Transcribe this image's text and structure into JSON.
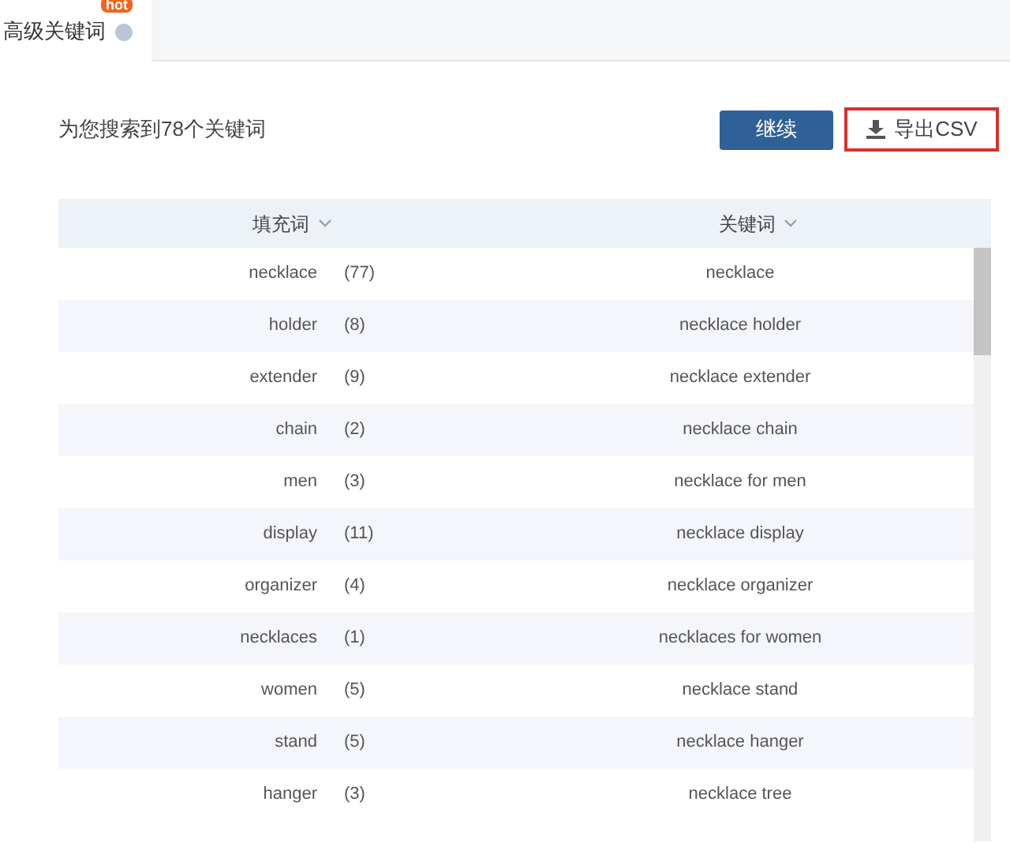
{
  "tabs": [
    {
      "label": "高级关键词",
      "badge": "hot",
      "selected": true
    }
  ],
  "summary": "为您搜索到78个关键词",
  "buttons": {
    "continue": "继续",
    "export": "导出CSV"
  },
  "table": {
    "columns": [
      {
        "label": "填充词"
      },
      {
        "label": "关键词"
      }
    ],
    "rows": [
      {
        "filler": "necklace",
        "count": "(77)",
        "keyword": "necklace"
      },
      {
        "filler": "holder",
        "count": "(8)",
        "keyword": "necklace holder"
      },
      {
        "filler": "extender",
        "count": "(9)",
        "keyword": "necklace extender"
      },
      {
        "filler": "chain",
        "count": "(2)",
        "keyword": "necklace chain"
      },
      {
        "filler": "men",
        "count": "(3)",
        "keyword": "necklace for men"
      },
      {
        "filler": "display",
        "count": "(11)",
        "keyword": "necklace display"
      },
      {
        "filler": "organizer",
        "count": "(4)",
        "keyword": "necklace organizer"
      },
      {
        "filler": "necklaces",
        "count": "(1)",
        "keyword": "necklaces for women"
      },
      {
        "filler": "women",
        "count": "(5)",
        "keyword": "necklace stand"
      },
      {
        "filler": "stand",
        "count": "(5)",
        "keyword": "necklace hanger"
      },
      {
        "filler": "hanger",
        "count": "(3)",
        "keyword": "necklace tree"
      }
    ]
  }
}
